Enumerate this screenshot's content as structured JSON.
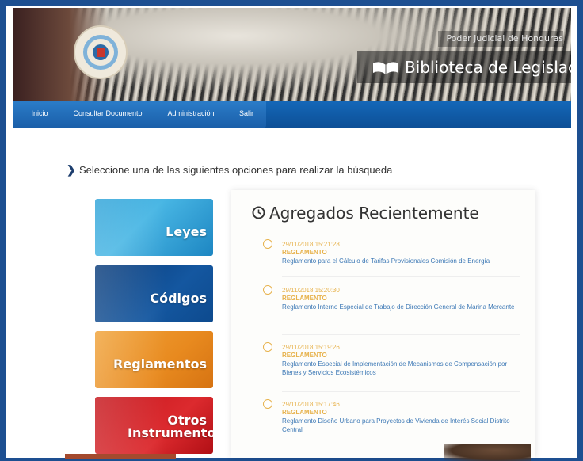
{
  "header": {
    "org_name": "Poder Judicial de Honduras",
    "site_title": "Biblioteca de Legislación"
  },
  "nav": {
    "items": [
      {
        "label": "Inicio"
      },
      {
        "label": "Consultar Documento"
      },
      {
        "label": "Administración"
      },
      {
        "label": "Salir"
      }
    ]
  },
  "main": {
    "prompt": "Seleccione una de las siguientes opciones para realizar la búsqueda",
    "tiles": [
      {
        "label": "Leyes",
        "color": "#2fa3d8"
      },
      {
        "label": "Códigos",
        "color": "#0f4a8e"
      },
      {
        "label": "Reglamentos",
        "color": "#e88a1f"
      },
      {
        "label": "Otros Instrumentos",
        "color": "#c5161c"
      }
    ]
  },
  "recent": {
    "title": "Agregados Recientemente",
    "entries": [
      {
        "timestamp": "29/11/2018 15:21:28",
        "type": "REGLAMENTO",
        "title": "Reglamento para el Cálculo de Tarifas Provisionales Comisión de Energía"
      },
      {
        "timestamp": "29/11/2018 15:20:30",
        "type": "REGLAMENTO",
        "title": "Reglamento Interno Especial de Trabajo de Dirección General de Marina Mercante"
      },
      {
        "timestamp": "29/11/2018 15:19:26",
        "type": "REGLAMENTO",
        "title": "Reglamento Especial de Implementación de Mecanismos de Compensación por Bienes y Servicios Ecosistémicos"
      },
      {
        "timestamp": "29/11/2018 15:17:46",
        "type": "REGLAMENTO",
        "title": "Reglamento Diseño Urbano para Proyectos de Vivienda de Interés Social Distrito Central"
      }
    ]
  },
  "colors": {
    "accent": "#e7b24c",
    "nav": "#1467b8",
    "link": "#3c78b5"
  }
}
